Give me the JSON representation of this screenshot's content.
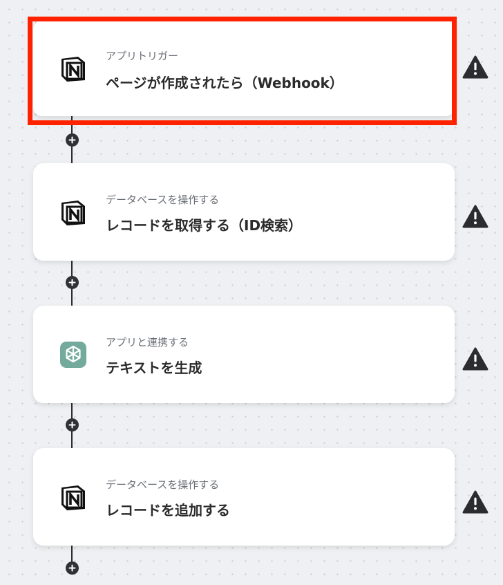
{
  "flow": {
    "steps": [
      {
        "type_label": "アプリトリガー",
        "title": "ページが作成されたら（Webhook）",
        "app_icon": "notion-icon",
        "selected": true,
        "warning": true
      },
      {
        "type_label": "データベースを操作する",
        "title": "レコードを取得する（ID検索）",
        "app_icon": "notion-icon",
        "selected": false,
        "warning": true
      },
      {
        "type_label": "アプリと連携する",
        "title": "テキストを生成",
        "app_icon": "chatgpt-icon",
        "selected": false,
        "warning": true
      },
      {
        "type_label": "データベースを操作する",
        "title": "レコードを追加する",
        "app_icon": "notion-icon",
        "selected": false,
        "warning": true
      }
    ]
  },
  "colors": {
    "highlight": "#ff2200",
    "background": "#eef0f3",
    "card": "#ffffff",
    "connector": "#2b2b2b",
    "chatgpt_brand": "#74aa9c"
  }
}
